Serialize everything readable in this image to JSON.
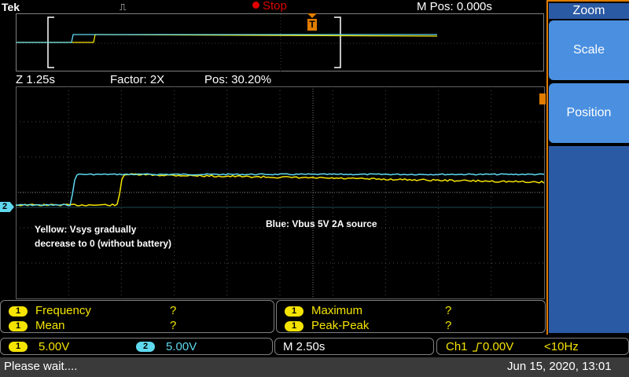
{
  "topbar": {
    "brand": "Tek",
    "trigger_glyph": "⎍",
    "run_state": "Stop",
    "horizontal_position": "M Pos: 0.000s"
  },
  "zoom_info": {
    "zoom_scale": "Z 1.25s",
    "factor": "Factor: 2X",
    "position": "Pos: 30.20%"
  },
  "annotations": {
    "yellow_note_line1": "Yellow: Vsys gradually",
    "yellow_note_line2": "decrease to 0 (without battery)",
    "blue_note": "Blue: Vbus 5V 2A source"
  },
  "channel_marker": "2",
  "trigger_marker": "T",
  "measurements": {
    "left": [
      {
        "channel": "1",
        "label": "Frequency",
        "value": "?"
      },
      {
        "channel": "1",
        "label": "Mean",
        "value": "?"
      }
    ],
    "right": [
      {
        "channel": "1",
        "label": "Maximum",
        "value": "?"
      },
      {
        "channel": "1",
        "label": "Peak-Peak",
        "value": "?"
      }
    ]
  },
  "channels": {
    "ch1_badge": "1",
    "ch1_scale": "5.00V",
    "ch2_badge": "2",
    "ch2_scale": "5.00V",
    "timebase": "M 2.50s",
    "trigger_source": "Ch1",
    "trigger_slope_icon": "rising-edge-icon",
    "trigger_level": "0.00V",
    "trigger_freq": "<10Hz"
  },
  "menu": {
    "title": "Zoom",
    "buttons": [
      "Scale",
      "Position"
    ]
  },
  "status": {
    "message": "Please wait....",
    "datetime": "Jun 15, 2020, 13:01"
  },
  "colors": {
    "ch1": "#f5e400",
    "ch2": "#5fd9f0",
    "menu_button": "#4a8fe0",
    "stop": "#e00000",
    "accent": "#e07c00"
  }
}
